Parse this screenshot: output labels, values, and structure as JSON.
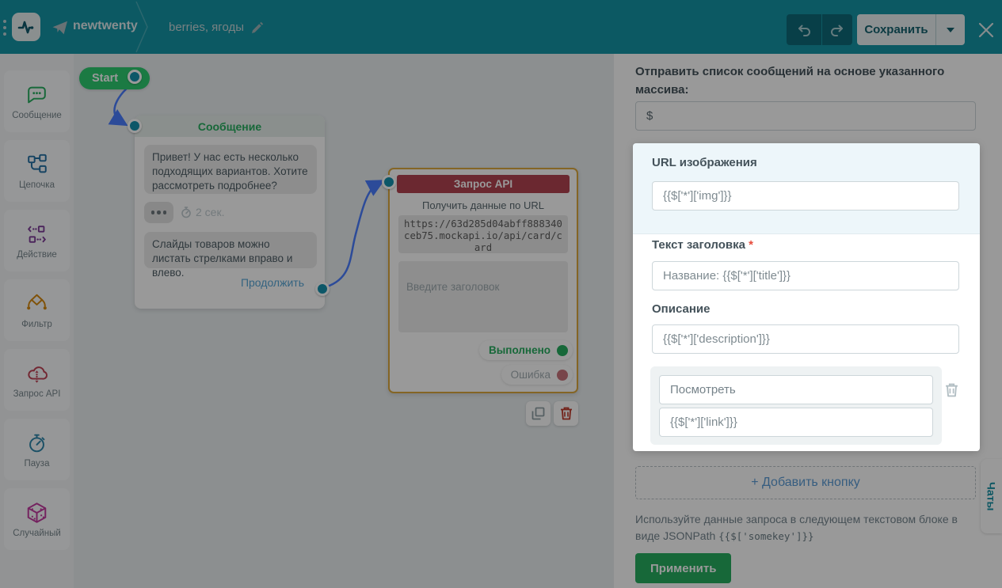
{
  "topbar": {
    "bot_name": "newtwenty",
    "flow_name": "berries, ягоды",
    "save_label": "Сохранить"
  },
  "sidebar": {
    "items": [
      {
        "label": "Сообщение",
        "icon": "message-icon"
      },
      {
        "label": "Цепочка",
        "icon": "chain-icon"
      },
      {
        "label": "Действие",
        "icon": "action-icon"
      },
      {
        "label": "Фильтр",
        "icon": "filter-icon"
      },
      {
        "label": "Запрос API",
        "icon": "api-request-icon"
      },
      {
        "label": "Пауза",
        "icon": "pause-icon"
      },
      {
        "label": "Случайный",
        "icon": "random-icon"
      }
    ]
  },
  "canvas": {
    "start_label": "Start",
    "message_node": {
      "title": "Сообщение",
      "bubble1": "Привет! У нас есть несколько подходящих вариантов. Хотите рассмотреть подробнее?",
      "delay": "2 сек.",
      "bubble2": "Слайды товаров можно листать стрелками вправо и влево.",
      "continue_label": "Продолжить"
    },
    "api_node": {
      "title": "Запрос API",
      "subtitle": "Получить данные по URL",
      "url": "https://63d285d04abff888340ceb75.mockapi.io/api/card/card",
      "title_placeholder": "Введите заголовок",
      "success_label": "Выполнено",
      "error_label": "Ошибка"
    }
  },
  "panel": {
    "intro_label": "Отправить список сообщений на основе указанного массива:",
    "array_value": "$",
    "card": {
      "image_url_label": "URL изображения",
      "image_url_value": "{{$['*']['img']}}",
      "title_label": "Текст заголовка",
      "required_mark": "*",
      "title_value": "Название: {{$['*']['title']}}",
      "description_label": "Описание",
      "description_value": "{{$['*']['description']}}",
      "button_text_value": "Посмотреть",
      "button_link_value": "{{$['*']['link']}}"
    },
    "add_button_label": "+ Добавить кнопку",
    "hint_prefix": "Используйте данные запроса в следующем текстовом блоке в виде JSONPath ",
    "hint_code": "{{$['somekey']}}",
    "apply_label": "Применить"
  },
  "chats_tab_label": "Чаты",
  "icons": {
    "logo": "pulse-line",
    "breadcrumb_bot": "paper-plane",
    "edit": "pencil",
    "undo": "curved-arrow-left",
    "redo": "curved-arrow-right",
    "close": "x",
    "copy": "copy",
    "delete": "trash",
    "delay": "stopwatch"
  },
  "colors": {
    "brand_teal": "#1595a5",
    "node_green": "#27ae60",
    "start_green": "#2ecc71",
    "api_header_red": "#b24350",
    "selection_gold": "#dca83f",
    "link_blue": "#58a6d6",
    "edge_blue": "#4a7dff",
    "danger_red": "#c0392b",
    "connector_teal": "#1592ad",
    "dim_overlay": "rgba(0,0,0,0.4)"
  }
}
